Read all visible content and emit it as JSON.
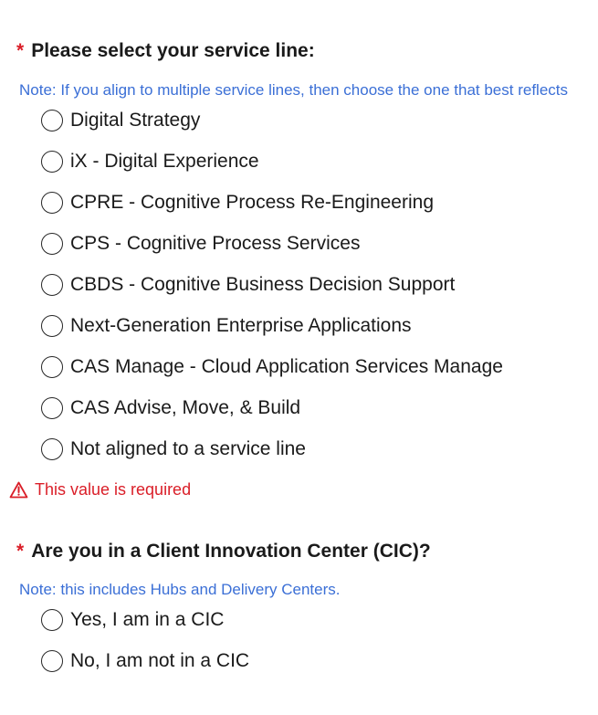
{
  "q1": {
    "required_marker": "*",
    "title": "Please select your service line:",
    "note": "Note: If you align to multiple service lines, then choose the one that best reflects",
    "options": [
      "Digital Strategy",
      "iX - Digital Experience",
      "CPRE - Cognitive Process Re-Engineering",
      "CPS - Cognitive Process Services",
      "CBDS - Cognitive Business Decision Support",
      "Next-Generation Enterprise Applications",
      "CAS Manage - Cloud Application Services Manage",
      "CAS Advise, Move, & Build",
      "Not aligned to a service line"
    ],
    "error": "This value is required"
  },
  "q2": {
    "required_marker": "*",
    "title": "Are you in a Client Innovation Center (CIC)?",
    "note": "Note: this includes Hubs and Delivery Centers.",
    "options": [
      "Yes, I am in a CIC",
      "No, I am not in a CIC"
    ]
  },
  "colors": {
    "required": "#da1e28",
    "note": "#3b6fd6",
    "text": "#1a1a1a"
  },
  "icons": {
    "error": "warning-triangle-icon"
  }
}
